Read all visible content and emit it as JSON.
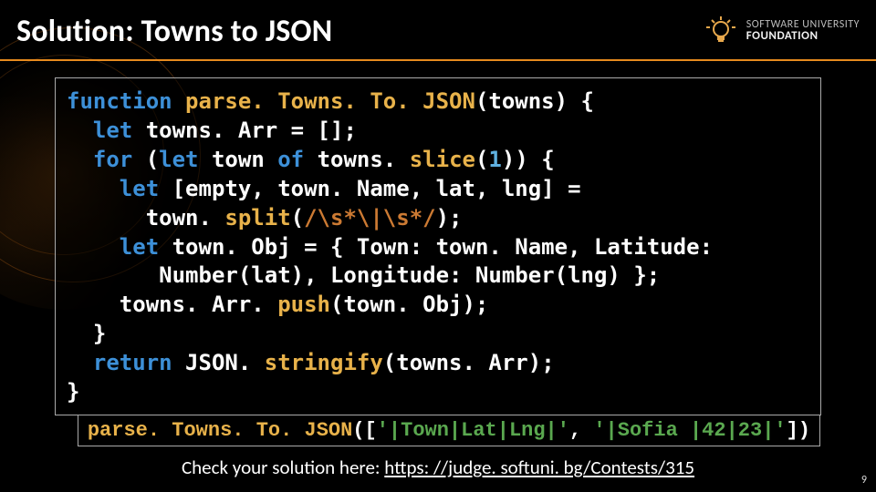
{
  "title": "Solution: Towns to JSON",
  "logo": {
    "line1": "SOFTWARE UNIVERSITY",
    "line2": "FOUNDATION"
  },
  "code_lines": {
    "l1_kw": "function",
    "l1_fn": " parse. Towns. To. JSON",
    "l1_rest": "(towns) {",
    "l2_kw": "  let",
    "l2_rest": " towns. Arr = [];",
    "l3_for": "  for",
    "l3_paren": " (",
    "l3_let": "let",
    "l3_mid": " town ",
    "l3_of": "of",
    "l3_slice_pre": " towns. ",
    "l3_slice": "slice",
    "l3_slice_post": "(",
    "l3_num": "1",
    "l3_tail": ")) {",
    "l4_kw": "    let",
    "l4_rest": " [empty, town. Name, lat, lng] =",
    "l5_pre": "      town. ",
    "l5_split": "split",
    "l5_open": "(",
    "l5_regex": "/\\s*\\|\\s*/",
    "l5_close": ");",
    "l6_kw": "    let",
    "l6_rest": " town. Obj = { Town: town. Name, Latitude:",
    "l7": "       Number(lat), Longitude: Number(lng) };",
    "l8_pre": "    towns. Arr. ",
    "l8_push": "push",
    "l8_rest": "(town. Obj);",
    "l9": "  }",
    "l10_kw": "  return",
    "l10_pre": " JSON. ",
    "l10_fn": "stringify",
    "l10_rest": "(towns. Arr);",
    "l11": "}"
  },
  "call": {
    "fn": "parse. Towns. To. JSON",
    "open": "([",
    "s1": "'|Town|Lat|Lng|'",
    "comma": ", ",
    "s2": "'|Sofia |42|23|'",
    "close": "])"
  },
  "footer": {
    "label": "Check your solution here: ",
    "link_text": "https: //judge. softuni. bg/Contests/315",
    "url": "https://judge.softuni.bg/Contests/315"
  },
  "page_number": "9"
}
